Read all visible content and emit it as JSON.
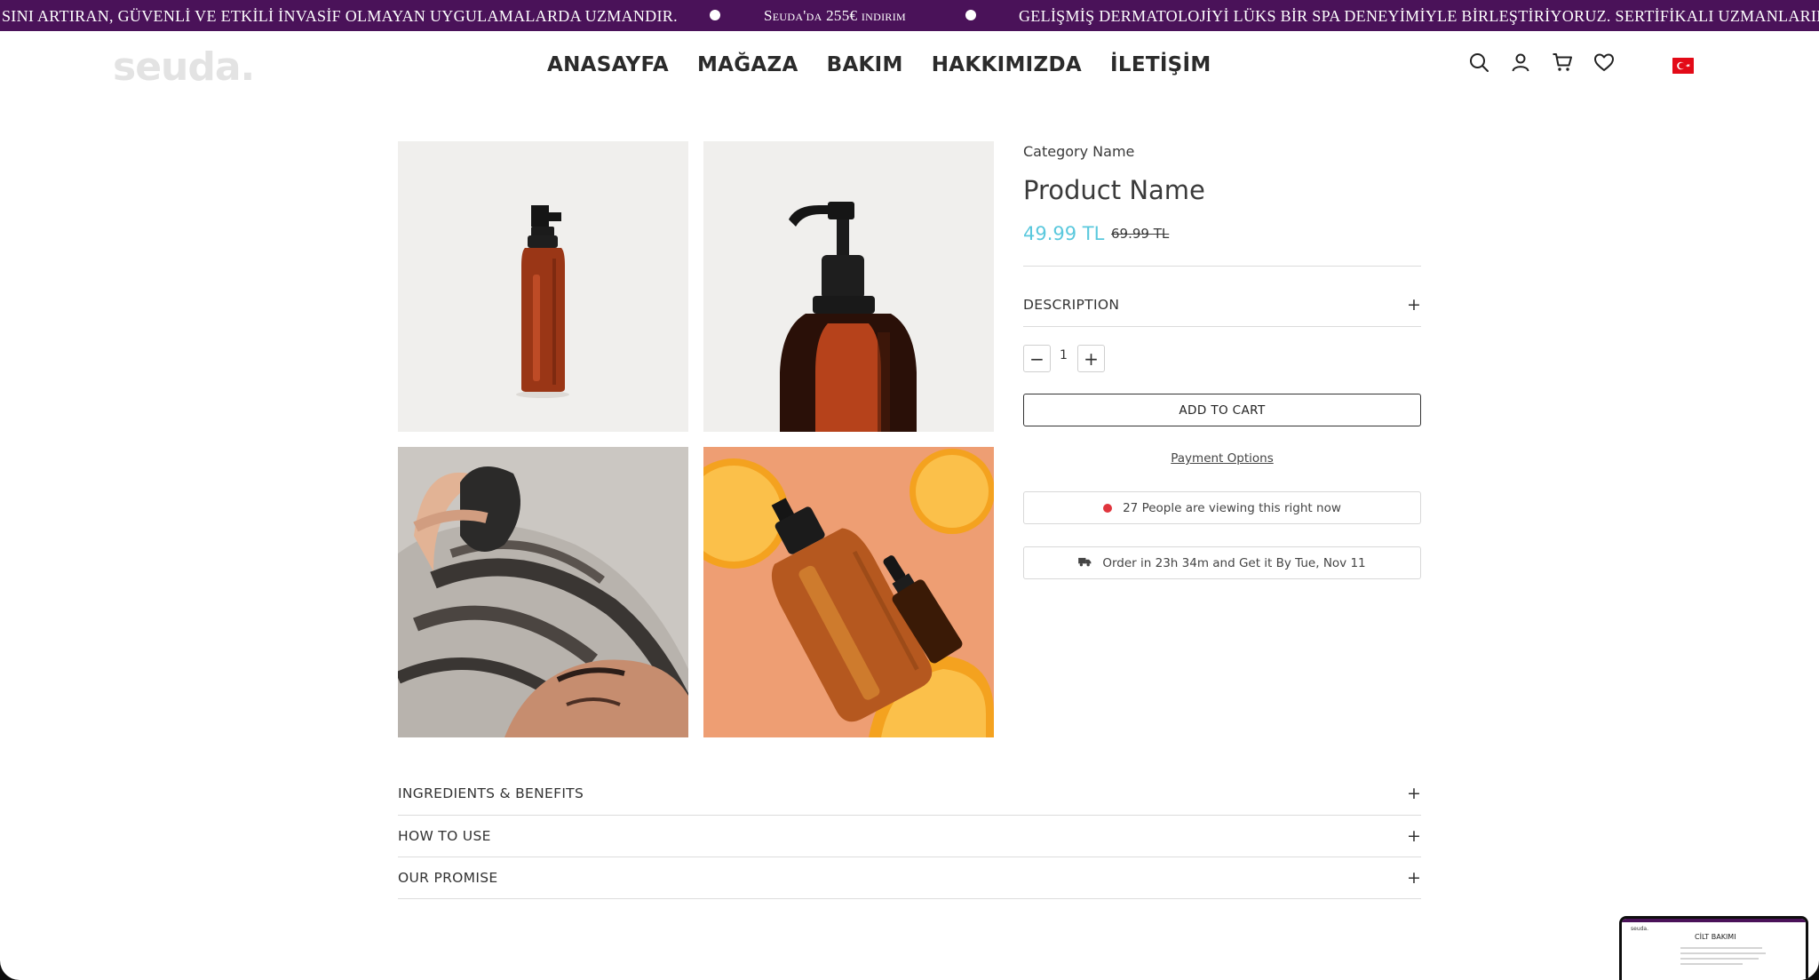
{
  "announcement": {
    "message_left": "SINI ARTIRAN, GÜVENLİ VE ETKİLİ İNVASİF OLMAYAN UYGULAMALARDA UZMANDIR.",
    "message_middle": "Seuda'da 255€ indirim",
    "message_right": "GELİŞMİŞ DERMATOLOJİYİ LÜKS BİR SPA DENEYİMİYLE BİRLEŞTİRİYORUZ. SERTİFİKALI UZMANLARIMIZ",
    "background": "#4a1259"
  },
  "header": {
    "logo": "seuda.",
    "nav": [
      "ANASAYFA",
      "MAĞAZA",
      "BAKIM",
      "HAKKIMIZDA",
      "İLETİŞİM"
    ],
    "icons": [
      "search-icon",
      "user-icon",
      "cart-icon",
      "heart-icon"
    ],
    "language_flag": "turkey-flag-icon"
  },
  "product": {
    "category": "Category Name",
    "name": "Product Name",
    "price": "49.99 TL",
    "old_price": "69.99 TL",
    "price_color": "#5ac8dd",
    "description_label": "DESCRIPTION",
    "quantity": "1",
    "add_to_cart": "ADD TO CART",
    "payment_options": "Payment Options",
    "viewers_text": "27 People are viewing this right now",
    "delivery_text": "Order in 23h 34m and Get it By Tue, Nov 11",
    "images": [
      "amber-pump-bottle",
      "amber-pump-bottle-closeup",
      "woman-hair-treatment",
      "amber-bottle-with-oranges"
    ]
  },
  "accordions": [
    "INGREDIENTS & BENEFITS",
    "HOW TO USE",
    "OUR PROMISE"
  ],
  "preview": {
    "logo": "seuda.",
    "title": "CİLT BAKIMI"
  }
}
